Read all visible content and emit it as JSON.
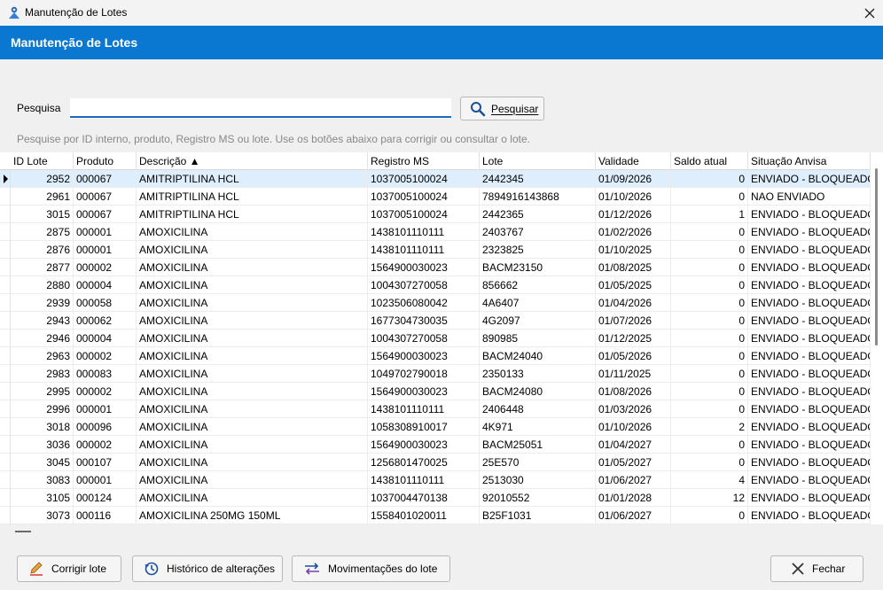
{
  "window": {
    "title": "Manutenção de Lotes"
  },
  "header": {
    "title": "Manutenção de Lotes"
  },
  "search": {
    "label": "Pesquisa",
    "value": "",
    "placeholder": "",
    "button_label": "Pesquisar",
    "help_text": "Pesquise por ID interno, produto, Registro MS ou lote. Use os botões abaixo para corrigir ou consultar o lote."
  },
  "grid": {
    "columns": [
      "ID Lote",
      "Produto",
      "Descrição ▲",
      "Registro MS",
      "Lote",
      "Validade",
      "Saldo atual",
      "Situação Anvisa"
    ],
    "rows": [
      {
        "id": "2952",
        "produto": "000067",
        "descricao": "AMITRIPTILINA HCL",
        "registro": "1037005100024",
        "lote": "2442345",
        "validade": "01/09/2026",
        "saldo": "0",
        "situacao": "ENVIADO - BLOQUEADO"
      },
      {
        "id": "2961",
        "produto": "000067",
        "descricao": "AMITRIPTILINA HCL",
        "registro": "1037005100024",
        "lote": "7894916143868",
        "validade": "01/10/2026",
        "saldo": "0",
        "situacao": "NAO ENVIADO"
      },
      {
        "id": "3015",
        "produto": "000067",
        "descricao": "AMITRIPTILINA HCL",
        "registro": "1037005100024",
        "lote": "2442365",
        "validade": "01/12/2026",
        "saldo": "1",
        "situacao": "ENVIADO - BLOQUEADO"
      },
      {
        "id": "2875",
        "produto": "000001",
        "descricao": "AMOXICILINA",
        "registro": "1438101110111",
        "lote": "2403767",
        "validade": "01/02/2026",
        "saldo": "0",
        "situacao": "ENVIADO - BLOQUEADO"
      },
      {
        "id": "2876",
        "produto": "000001",
        "descricao": "AMOXICILINA",
        "registro": "1438101110111",
        "lote": "2323825",
        "validade": "01/10/2025",
        "saldo": "0",
        "situacao": "ENVIADO - BLOQUEADO"
      },
      {
        "id": "2877",
        "produto": "000002",
        "descricao": "AMOXICILINA",
        "registro": "1564900030023",
        "lote": "BACM23150",
        "validade": "01/08/2025",
        "saldo": "0",
        "situacao": "ENVIADO - BLOQUEADO"
      },
      {
        "id": "2880",
        "produto": "000004",
        "descricao": "AMOXICILINA",
        "registro": "1004307270058",
        "lote": "856662",
        "validade": "01/05/2025",
        "saldo": "0",
        "situacao": "ENVIADO - BLOQUEADO"
      },
      {
        "id": "2939",
        "produto": "000058",
        "descricao": "AMOXICILINA",
        "registro": "1023506080042",
        "lote": "4A6407",
        "validade": "01/04/2026",
        "saldo": "0",
        "situacao": "ENVIADO - BLOQUEADO"
      },
      {
        "id": "2943",
        "produto": "000062",
        "descricao": "AMOXICILINA",
        "registro": "1677304730035",
        "lote": "4G2097",
        "validade": "01/07/2026",
        "saldo": "0",
        "situacao": "ENVIADO - BLOQUEADO"
      },
      {
        "id": "2946",
        "produto": "000004",
        "descricao": "AMOXICILINA",
        "registro": "1004307270058",
        "lote": "890985",
        "validade": "01/12/2025",
        "saldo": "0",
        "situacao": "ENVIADO - BLOQUEADO"
      },
      {
        "id": "2963",
        "produto": "000002",
        "descricao": "AMOXICILINA",
        "registro": "1564900030023",
        "lote": "BACM24040",
        "validade": "01/05/2026",
        "saldo": "0",
        "situacao": "ENVIADO - BLOQUEADO"
      },
      {
        "id": "2983",
        "produto": "000083",
        "descricao": "AMOXICILINA",
        "registro": "1049702790018",
        "lote": "2350133",
        "validade": "01/11/2025",
        "saldo": "0",
        "situacao": "ENVIADO - BLOQUEADO"
      },
      {
        "id": "2995",
        "produto": "000002",
        "descricao": "AMOXICILINA",
        "registro": "1564900030023",
        "lote": "BACM24080",
        "validade": "01/08/2026",
        "saldo": "0",
        "situacao": "ENVIADO - BLOQUEADO"
      },
      {
        "id": "2996",
        "produto": "000001",
        "descricao": "AMOXICILINA",
        "registro": "1438101110111",
        "lote": "2406448",
        "validade": "01/03/2026",
        "saldo": "0",
        "situacao": "ENVIADO - BLOQUEADO"
      },
      {
        "id": "3018",
        "produto": "000096",
        "descricao": "AMOXICILINA",
        "registro": "1058308910017",
        "lote": "4K971",
        "validade": "01/10/2026",
        "saldo": "2",
        "situacao": "ENVIADO - BLOQUEADO"
      },
      {
        "id": "3036",
        "produto": "000002",
        "descricao": "AMOXICILINA",
        "registro": "1564900030023",
        "lote": "BACM25051",
        "validade": "01/04/2027",
        "saldo": "0",
        "situacao": "ENVIADO - BLOQUEADO"
      },
      {
        "id": "3045",
        "produto": "000107",
        "descricao": "AMOXICILINA",
        "registro": "1256801470025",
        "lote": "25E570",
        "validade": "01/05/2027",
        "saldo": "0",
        "situacao": "ENVIADO - BLOQUEADO"
      },
      {
        "id": "3083",
        "produto": "000001",
        "descricao": "AMOXICILINA",
        "registro": "1438101110111",
        "lote": "2513030",
        "validade": "01/06/2027",
        "saldo": "4",
        "situacao": "ENVIADO - BLOQUEADO"
      },
      {
        "id": "3105",
        "produto": "000124",
        "descricao": "AMOXICILINA",
        "registro": "1037004470138",
        "lote": "92010552",
        "validade": "01/01/2028",
        "saldo": "12",
        "situacao": "ENVIADO - BLOQUEADO"
      },
      {
        "id": "3073",
        "produto": "000116",
        "descricao": "AMOXICILINA  250MG 150ML",
        "registro": "1558401020011",
        "lote": "B25F1031",
        "validade": "01/06/2027",
        "saldo": "0",
        "situacao": "ENVIADO - BLOQUEADO"
      }
    ]
  },
  "footer": {
    "corrigir_label": "Corrigir lote",
    "historico_label": "Histórico de alterações",
    "movimentacoes_label": "Movimentações do lote",
    "fechar_label": "Fechar"
  },
  "colors": {
    "accent": "#0a78d1",
    "selected_row": "#dfeefc"
  }
}
